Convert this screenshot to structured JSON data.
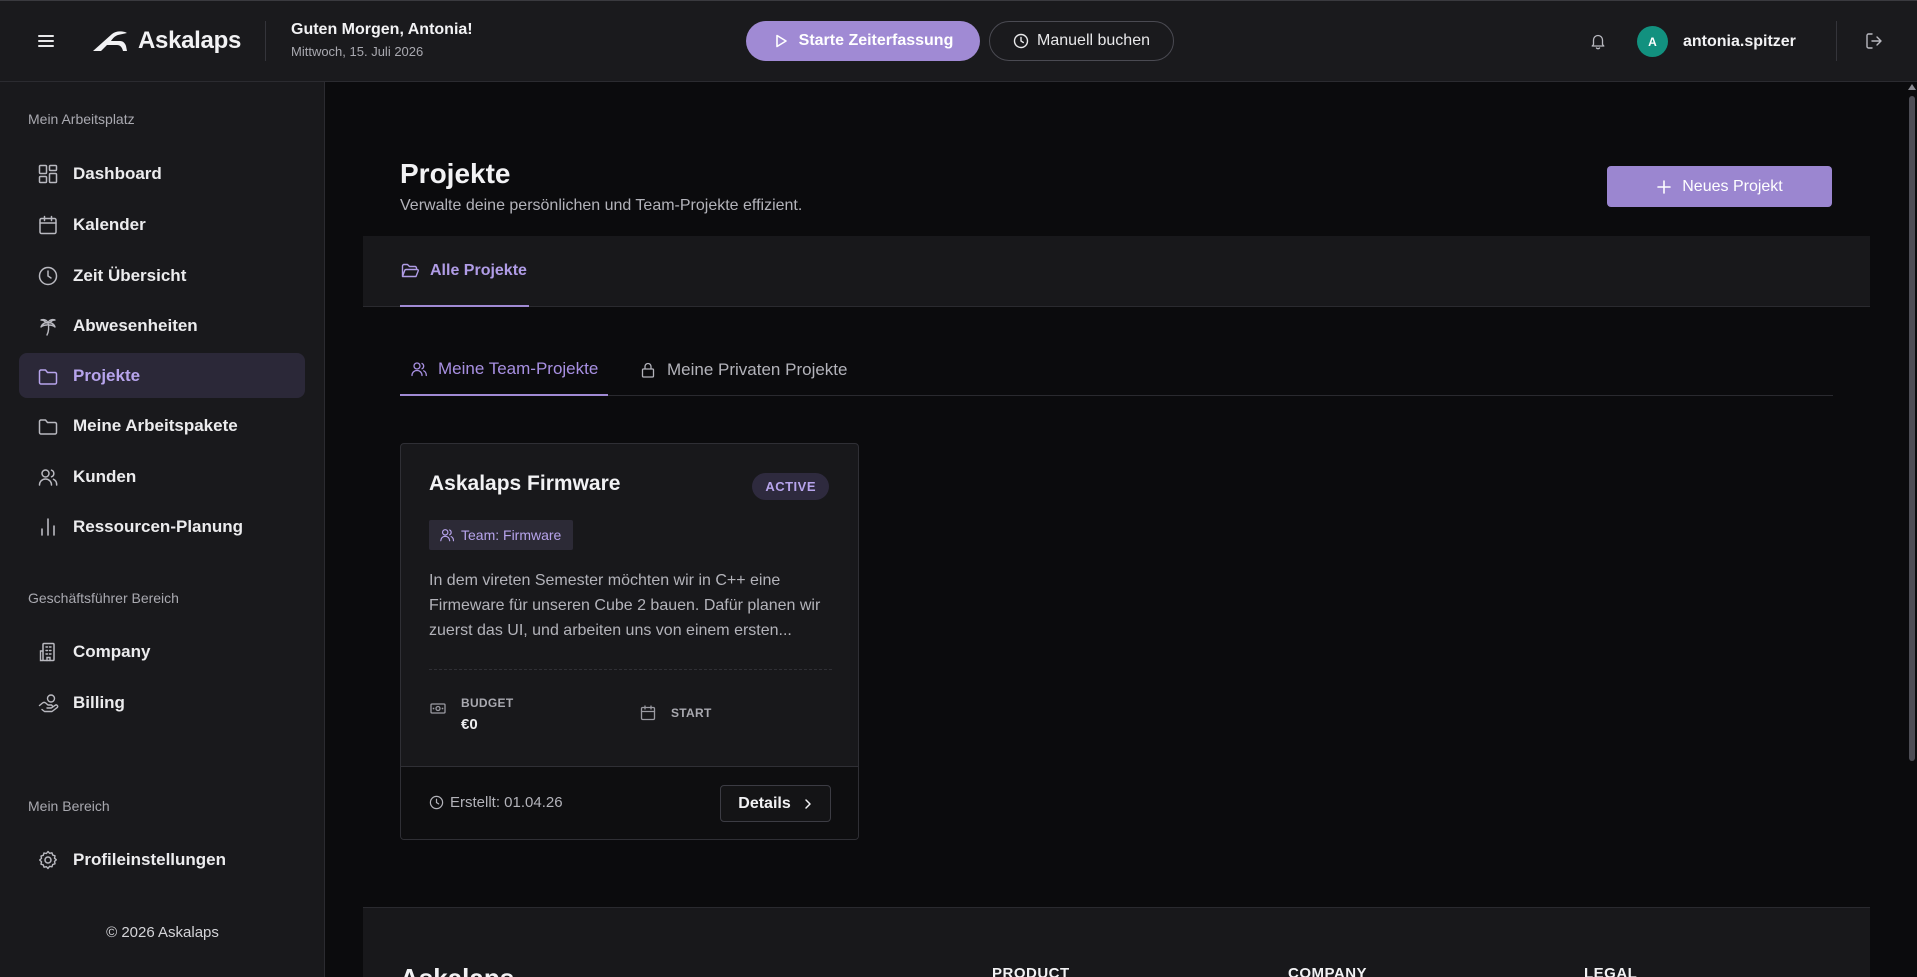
{
  "header": {
    "brand": "Askalaps",
    "greeting": "Guten Morgen, Antonia!",
    "date": "Mittwoch, 15. Juli 2026",
    "start_label": "Starte Zeiterfassung",
    "manual_label": "Manuell buchen",
    "avatar_initial": "A",
    "username": "antonia.spitzer"
  },
  "sidebar": {
    "section_workspace": "Mein Arbeitsplatz",
    "items": [
      {
        "label": "Dashboard",
        "icon": "dashboard-icon"
      },
      {
        "label": "Kalender",
        "icon": "calendar-icon"
      },
      {
        "label": "Zeit Übersicht",
        "icon": "clock-icon"
      },
      {
        "label": "Abwesenheiten",
        "icon": "palm-tree-icon"
      },
      {
        "label": "Projekte",
        "icon": "folder-icon",
        "active": true
      },
      {
        "label": "Meine Arbeitspakete",
        "icon": "folder-icon"
      },
      {
        "label": "Kunden",
        "icon": "users-icon"
      },
      {
        "label": "Ressourcen-Planung",
        "icon": "bar-chart-icon"
      }
    ],
    "section_management": "Geschäftsführer Bereich",
    "management_items": [
      {
        "label": "Company",
        "icon": "building-icon"
      },
      {
        "label": "Billing",
        "icon": "hand-coins-icon"
      }
    ],
    "section_personal": "Mein Bereich",
    "personal_items": [
      {
        "label": "Profileinstellungen",
        "icon": "gear-icon"
      }
    ],
    "copyright": "© 2026 Askalaps"
  },
  "main": {
    "title": "Projekte",
    "subtitle": "Verwalte deine persönlichen und Team-Projekte effizient.",
    "new_project_label": "Neues Projekt",
    "tab_all": "Alle Projekte",
    "subtab_team": "Meine Team-Projekte",
    "subtab_private": "Meine Privaten Projekte",
    "card": {
      "title": "Askalaps Firmware",
      "status": "ACTIVE",
      "team": "Team: Firmware",
      "description": "In dem vireten Semester möchten wir in C++ eine Firmeware für unseren Cube 2 bauen. Dafür planen wir zuerst das UI, und arbeiten uns von einem ersten...",
      "budget_label": "BUDGET",
      "budget_value": "€0",
      "start_label": "START",
      "created": "Erstellt: 01.04.26",
      "details_label": "Details"
    }
  },
  "footer": {
    "brand": "Askalaps",
    "col_product": "PRODUCT",
    "col_company": "COMPANY",
    "col_legal": "LEGAL"
  },
  "colors": {
    "accent": "#a08ad4",
    "background": "#0b0b0d",
    "panel": "#19191c",
    "avatar": "#12917f"
  }
}
